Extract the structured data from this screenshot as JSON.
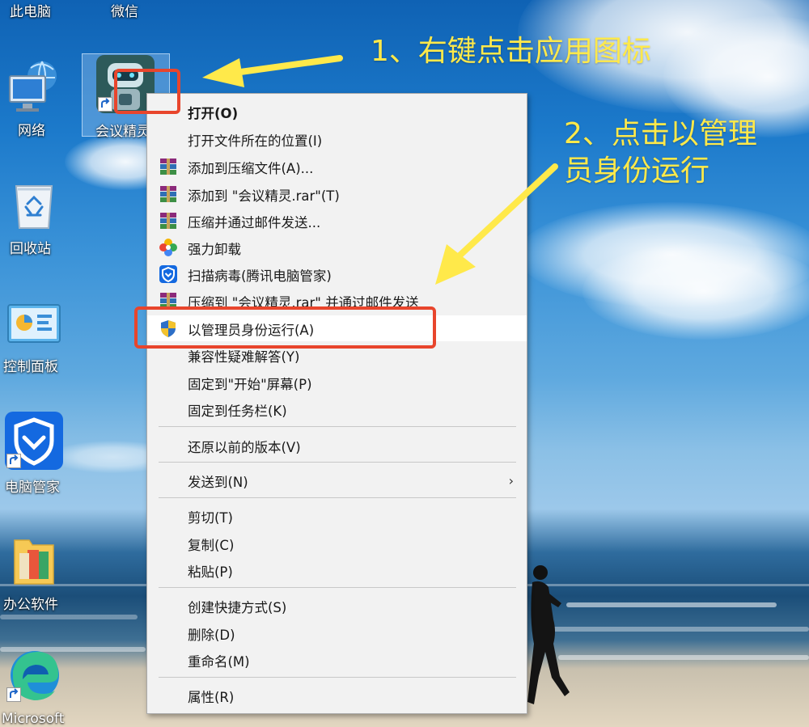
{
  "desktop": {
    "top_labels": [
      "此电脑",
      "微信"
    ],
    "icons": [
      {
        "label": "网络"
      },
      {
        "label": "回收站"
      },
      {
        "label": "控制面板"
      },
      {
        "label": "电脑管家"
      },
      {
        "label": "办公软件"
      },
      {
        "label": "Microsoft"
      }
    ],
    "selected_app": {
      "label": "会议精灵"
    }
  },
  "context_menu": {
    "items": [
      {
        "label": "打开(O)"
      },
      {
        "label": "打开文件所在的位置(I)"
      },
      {
        "label": "添加到压缩文件(A)..."
      },
      {
        "label": "添加到 \"会议精灵.rar\"(T)"
      },
      {
        "label": "压缩并通过邮件发送..."
      },
      {
        "label": "强力卸载"
      },
      {
        "label": "扫描病毒(腾讯电脑管家)"
      },
      {
        "label": "压缩到 \"会议精灵.rar\" 并通过邮件发送"
      },
      {
        "label": "以管理员身份运行(A)"
      },
      {
        "label": "兼容性疑难解答(Y)"
      },
      {
        "label": "固定到\"开始\"屏幕(P)"
      },
      {
        "label": "固定到任务栏(K)"
      },
      {
        "label": "还原以前的版本(V)"
      },
      {
        "label": "发送到(N)"
      },
      {
        "label": "剪切(T)"
      },
      {
        "label": "复制(C)"
      },
      {
        "label": "粘贴(P)"
      },
      {
        "label": "创建快捷方式(S)"
      },
      {
        "label": "删除(D)"
      },
      {
        "label": "重命名(M)"
      },
      {
        "label": "属性(R)"
      }
    ],
    "submenu_arrow": "›"
  },
  "annotations": {
    "step1": "1、右键点击应用图标",
    "step2_line1": "2、点击以管理",
    "step2_line2": "员身份运行"
  },
  "colors": {
    "annotation_yellow": "#ffe94a",
    "highlight_red": "#e8452c",
    "menu_bg": "#f2f2f2"
  }
}
